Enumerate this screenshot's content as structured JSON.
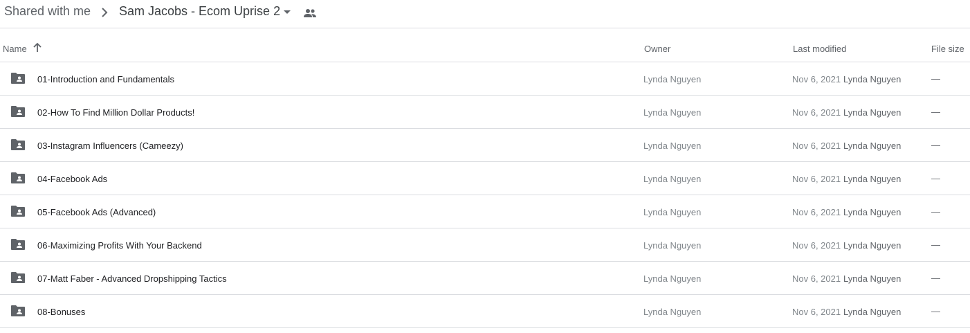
{
  "breadcrumb": {
    "root": "Shared with me",
    "current": "Sam Jacobs - Ecom Uprise 2"
  },
  "columns": {
    "name": "Name",
    "owner": "Owner",
    "last_modified": "Last modified",
    "file_size": "File size"
  },
  "colors": {
    "folder_icon": "#5f6368",
    "divider": "#dadce0"
  },
  "rows": [
    {
      "name": "01-Introduction and Fundamentals",
      "owner": "Lynda Nguyen",
      "date": "Nov 6, 2021",
      "modified_by": "Lynda Nguyen",
      "size": "—"
    },
    {
      "name": "02-How To Find Million Dollar Products!",
      "owner": "Lynda Nguyen",
      "date": "Nov 6, 2021",
      "modified_by": "Lynda Nguyen",
      "size": "—"
    },
    {
      "name": "03-Instagram Influencers (Cameezy)",
      "owner": "Lynda Nguyen",
      "date": "Nov 6, 2021",
      "modified_by": "Lynda Nguyen",
      "size": "—"
    },
    {
      "name": "04-Facebook Ads",
      "owner": "Lynda Nguyen",
      "date": "Nov 6, 2021",
      "modified_by": "Lynda Nguyen",
      "size": "—"
    },
    {
      "name": "05-Facebook Ads (Advanced)",
      "owner": "Lynda Nguyen",
      "date": "Nov 6, 2021",
      "modified_by": "Lynda Nguyen",
      "size": "—"
    },
    {
      "name": "06-Maximizing Profits With Your Backend",
      "owner": "Lynda Nguyen",
      "date": "Nov 6, 2021",
      "modified_by": "Lynda Nguyen",
      "size": "—"
    },
    {
      "name": "07-Matt Faber - Advanced Dropshipping Tactics",
      "owner": "Lynda Nguyen",
      "date": "Nov 6, 2021",
      "modified_by": "Lynda Nguyen",
      "size": "—"
    },
    {
      "name": "08-Bonuses",
      "owner": "Lynda Nguyen",
      "date": "Nov 6, 2021",
      "modified_by": "Lynda Nguyen",
      "size": "—"
    }
  ]
}
